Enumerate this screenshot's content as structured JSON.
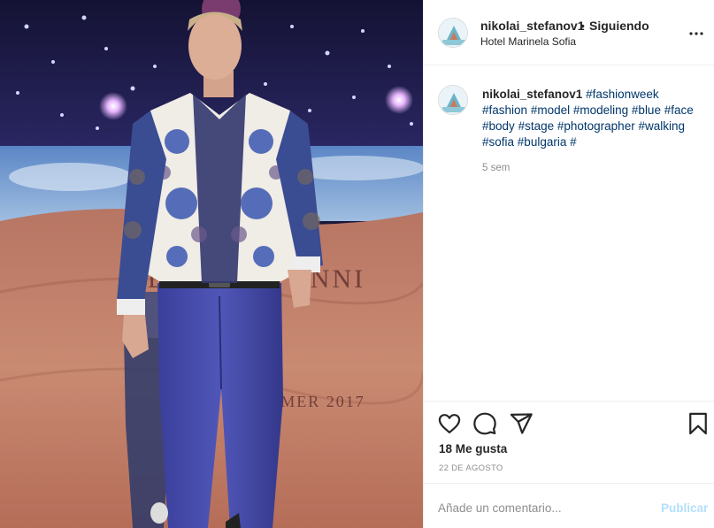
{
  "post": {
    "photo_backdrop_text": "DIVINO VONNI",
    "photo_backdrop_season": "MER 2017"
  },
  "header": {
    "username": "nikolai_stefanov1",
    "separator": "•",
    "follow_status": "Siguiendo",
    "location": "Hotel Marinela Sofia"
  },
  "caption": {
    "username": "nikolai_stefanov1",
    "hashtags": [
      "#fashionweek",
      "#fashion",
      "#model",
      "#modeling",
      "#blue",
      "#face",
      "#body",
      "#stage",
      "#photographer",
      "#walking",
      "#sofia",
      "#bulgaria",
      "#"
    ],
    "time_ago": "5 sem"
  },
  "actions": {
    "like_icon": "heart-icon",
    "comment_icon": "comment-bubble-icon",
    "share_icon": "paper-plane-icon",
    "save_icon": "bookmark-icon",
    "likes": "18 Me gusta",
    "date": "22 DE AGOSTO"
  },
  "comment_box": {
    "placeholder": "Añade un comentario...",
    "post_label": "Publicar",
    "post_color_disabled": "#b2dffc"
  },
  "colors": {
    "text": "#262626",
    "secondary": "#8e8e8e",
    "hashtag": "#00376b",
    "border": "#efefef"
  }
}
